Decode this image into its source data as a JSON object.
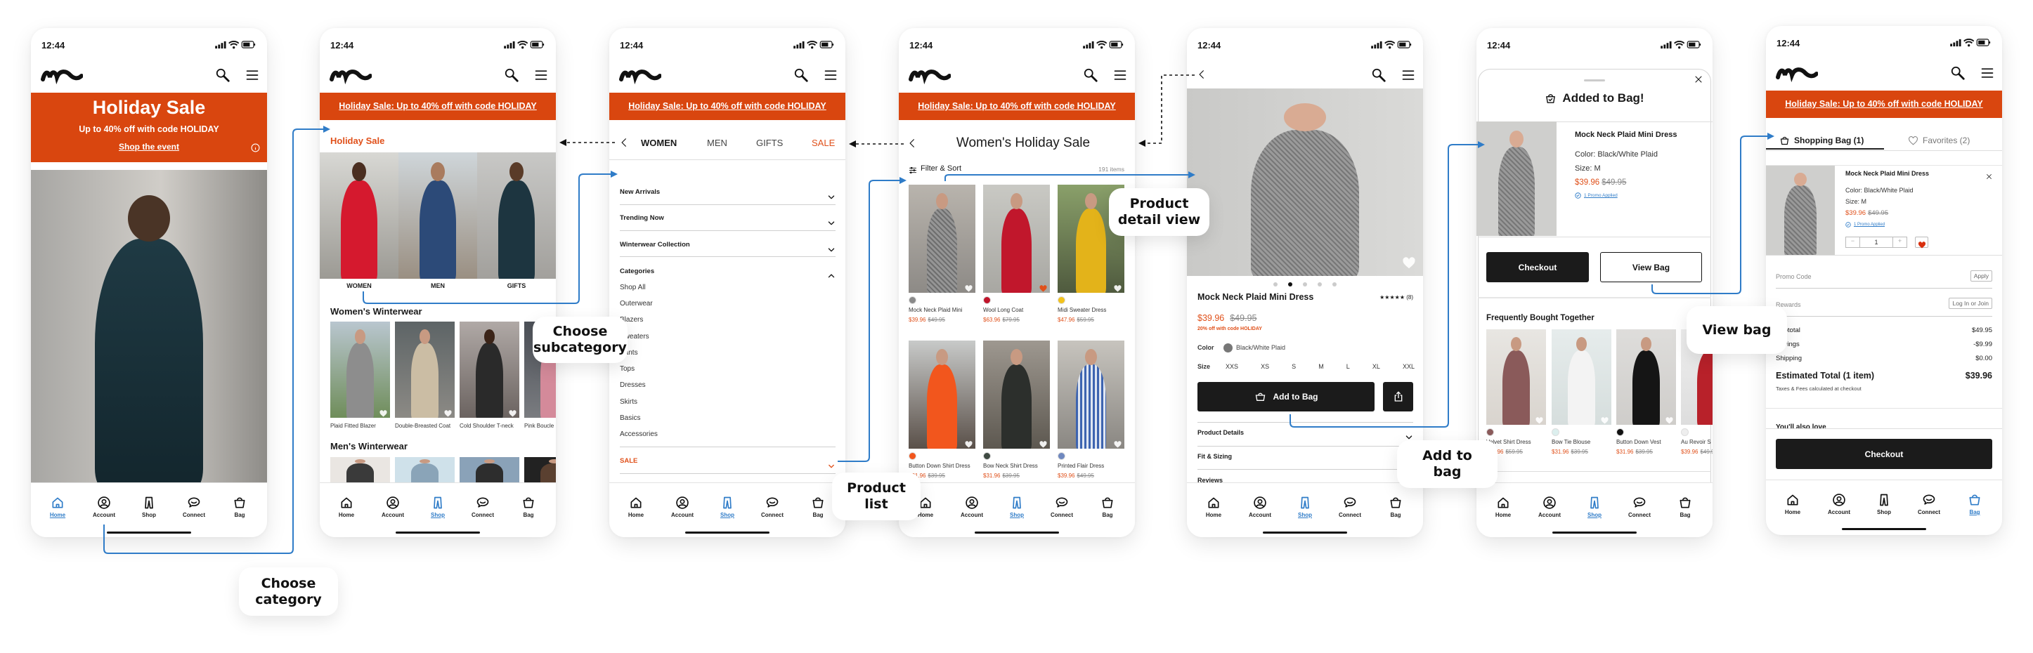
{
  "status": {
    "time": "12:44"
  },
  "banner": {
    "text": "Holiday Sale: Up to 40% off with code HOLIDAY"
  },
  "colors": {
    "brand_orange": "#d9460f",
    "sale_price": "#e0501a",
    "accent_blue": "#2f7cc8",
    "button_dark": "#1b1b1b"
  },
  "tabbar": {
    "items": [
      {
        "label": "Home",
        "icon": "home-icon"
      },
      {
        "label": "Account",
        "icon": "account-icon"
      },
      {
        "label": "Shop",
        "icon": "shop-icon"
      },
      {
        "label": "Connect",
        "icon": "connect-icon"
      },
      {
        "label": "Bag",
        "icon": "bag-icon"
      }
    ]
  },
  "screens": [
    {
      "active_tab": 0
    },
    {
      "active_tab": 2
    },
    {
      "active_tab": 2
    },
    {
      "active_tab": 2
    },
    {
      "active_tab": 2
    },
    {
      "active_tab": 2
    },
    {
      "active_tab": 4
    }
  ],
  "home": {
    "hero_title": "Holiday Sale",
    "hero_subtitle": "Up to 40% off with code HOLIDAY",
    "hero_link": "Shop the event"
  },
  "landing": {
    "section_title": "Holiday Sale",
    "categories": [
      "WOMEN",
      "MEN",
      "GIFTS"
    ],
    "womens_title": "Women's Winterwear",
    "womens_items": [
      "Plaid Fitted Blazer",
      "Double-Breasted Coat",
      "Cold Shoulder T-neck",
      "Pink Boucle"
    ],
    "mens_title": "Men's Winterwear"
  },
  "menu": {
    "tabs": [
      "WOMEN",
      "MEN",
      "GIFTS",
      "SALE"
    ],
    "sections": [
      "New Arrivals",
      "Trending Now",
      "Winterwear Collection"
    ],
    "categories_title": "Categories",
    "categories": [
      "Shop All",
      "Outerwear",
      "Blazers",
      "Sweaters",
      "Pants",
      "Tops",
      "Dresses",
      "Skirts",
      "Basics",
      "Accessories"
    ],
    "sale": "SALE"
  },
  "plp": {
    "title": "Women's Holiday Sale",
    "filter": "Filter & Sort",
    "count": "191 items",
    "products": [
      {
        "name": "Mock Neck Plaid Mini",
        "price": "$39.96",
        "was": "$49.95",
        "swatch": "#8a8a8a",
        "favorited": false
      },
      {
        "name": "Wool Long Coat",
        "price": "$63.96",
        "was": "$79.95",
        "swatch": "#c0142a",
        "favorited": true
      },
      {
        "name": "Midi Sweater Dress",
        "price": "$47.96",
        "was": "$59.95",
        "swatch": "#f2c21b",
        "favorited": false
      },
      {
        "name": "Button Down Shirt Dress",
        "price": "$31.96",
        "was": "$39.95",
        "swatch": "#f2561d",
        "favorited": false
      },
      {
        "name": "Bow Neck Shirt Dress",
        "price": "$31.96",
        "was": "$39.95",
        "swatch": "#3f4a42",
        "favorited": false
      },
      {
        "name": "Printed Flair Dress",
        "price": "$39.96",
        "was": "$49.95",
        "swatch": "#6f88bf",
        "favorited": false
      }
    ]
  },
  "pdp": {
    "name": "Mock Neck Plaid Mini Dress",
    "rating": 5,
    "review_count": "(8)",
    "price": "$39.96",
    "was": "$49.95",
    "promo": "20% off with code HOLIDAY",
    "color_label": "Color",
    "color_value": "Black/White Plaid",
    "size_label": "Size",
    "sizes": [
      "XXS",
      "XS",
      "S",
      "M",
      "L",
      "XL",
      "XXL"
    ],
    "add_to_bag": "Add to Bag",
    "sections": [
      "Product Details",
      "Fit & Sizing",
      "Reviews"
    ],
    "image_count": 5,
    "image_index": 2
  },
  "added": {
    "title": "Added to Bag!",
    "name": "Mock Neck Plaid Mini Dress",
    "color": "Color: Black/White Plaid",
    "size": "Size: M",
    "price": "$39.96",
    "was": "$49.95",
    "promo": "1 Promo Applied",
    "checkout": "Checkout",
    "view_bag": "View Bag",
    "fbt_title": "Frequently Bought Together",
    "fbt": [
      {
        "name": "Velvet Shirt Dress",
        "price": "$47.96",
        "was": "$59.95",
        "swatch": "#8a5a5a"
      },
      {
        "name": "Bow Tie Blouse",
        "price": "$31.96",
        "was": "$39.95",
        "swatch": "#dcefee"
      },
      {
        "name": "Button Down Vest",
        "price": "$31.96",
        "was": "$39.95",
        "swatch": "#111111"
      },
      {
        "name": "Au Revoir S",
        "price": "$39.96",
        "was": "$49.95",
        "swatch": "#eeeeee"
      }
    ]
  },
  "bag": {
    "tab_bag": "Shopping Bag (1)",
    "tab_favorites": "Favorites (2)",
    "name": "Mock Neck Plaid Mini Dress",
    "color": "Color: Black/White Plaid",
    "size": "Size: M",
    "price": "$39.96",
    "was": "$49.95",
    "promo": "1 Promo Applied",
    "quantity": "1",
    "promo_code_label": "Promo Code",
    "apply": "Apply",
    "rewards_label": "Rewards",
    "login": "Log In or Join",
    "summary": [
      {
        "label": "Subtotal",
        "value": "$49.95"
      },
      {
        "label": "Savings",
        "value": "-$9.99"
      },
      {
        "label": "Shipping",
        "value": "$0.00"
      }
    ],
    "total_label": "Estimated Total (1 item)",
    "total_value": "$39.96",
    "taxes_note": "Taxes & Fees calculated at checkout",
    "also_love": "You'll also love",
    "checkout": "Checkout"
  },
  "callouts": {
    "choose_category": "Choose category",
    "choose_subcategory": "Choose subcategory",
    "product_list": "Product list",
    "product_detail": "Product detail view",
    "add_to_bag": "Add to bag",
    "view_bag": "View bag"
  }
}
